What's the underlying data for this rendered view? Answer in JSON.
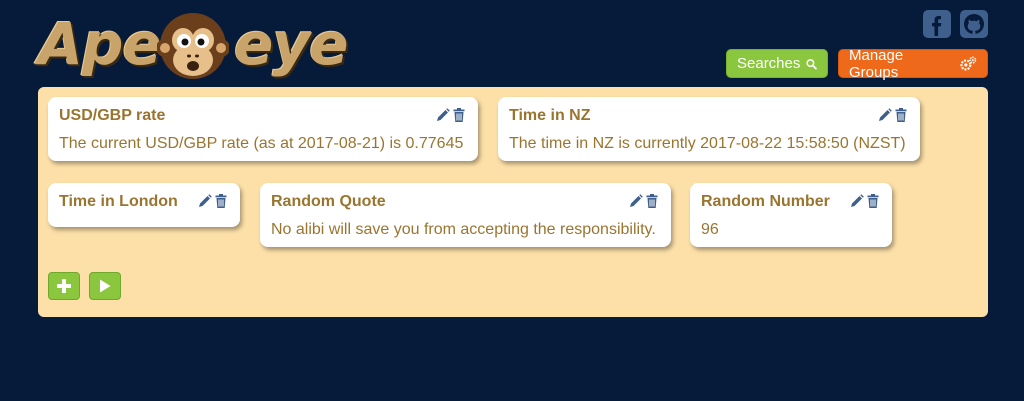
{
  "brand": {
    "left": "Ape",
    "right": "eye"
  },
  "header": {
    "social": [
      "facebook-icon",
      "github-icon"
    ],
    "searches_label": "Searches",
    "groups_label": "Manage Groups"
  },
  "colors": {
    "background": "#061a3a",
    "panel": "#fde0a8",
    "card_text": "#9a7530",
    "green": "#8bc63f",
    "orange": "#ee6a1a",
    "icon": "#3f5f8c"
  },
  "cards": [
    {
      "title": "USD/GBP rate",
      "body": "The current USD/GBP rate (as at 2017-08-21) is 0.77645"
    },
    {
      "title": "Time in NZ",
      "body": "The time in NZ is currently 2017-08-22 15:58:50 (NZST)"
    },
    {
      "title": "Time in London",
      "body": ""
    },
    {
      "title": "Random Quote",
      "body": "No alibi will save you from accepting the responsibility."
    },
    {
      "title": "Random Number",
      "body": "96"
    }
  ],
  "actions": {
    "add": "plus-icon",
    "run": "play-icon"
  }
}
